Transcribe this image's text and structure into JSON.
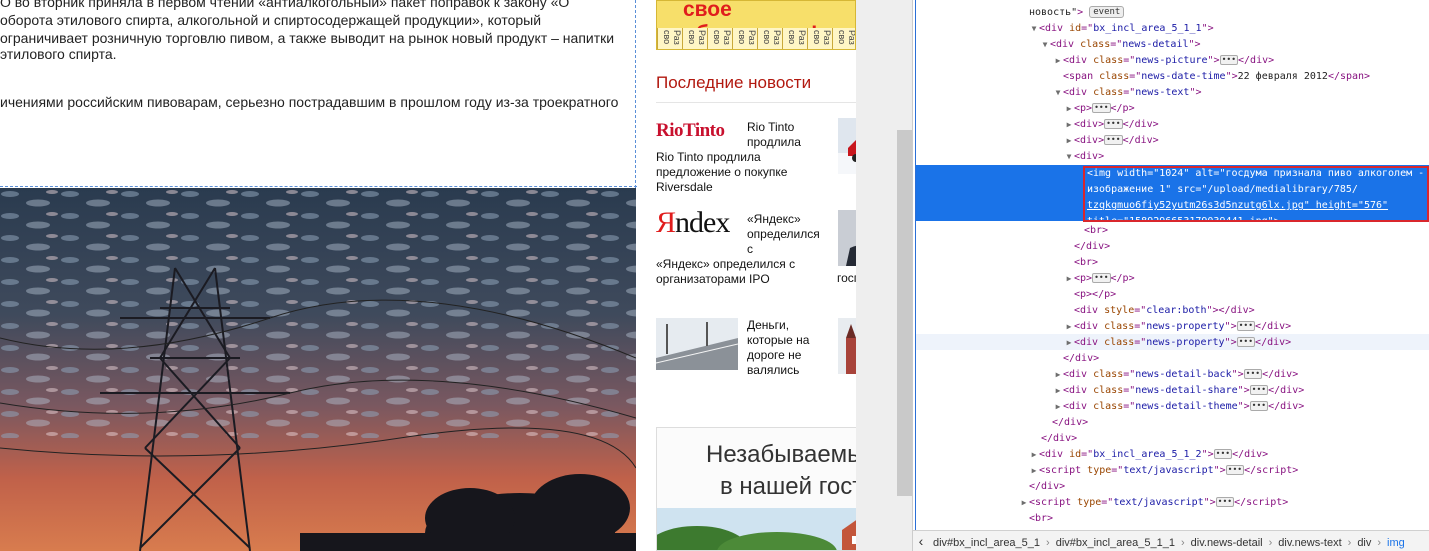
{
  "article": {
    "lines": [
      "О во вторник приняла в первом чтении «антиалкогольный» пакет поправок к закону «О",
      "оборота этилового спирта, алкогольной и спиртосодержащей продукции», который",
      "ограничивает розничную торговлю пивом, а также выводит на рынок новый продукт – напитки",
      "этилового спирта.",
      "ичениями российским пивоварам, серьезно пострадавшим в прошлом году из-за троекратного"
    ]
  },
  "sidebar": {
    "top_banner": {
      "text": "свое объявление!",
      "cells": [
        "Раз сво",
        "Раз сво",
        "Раз сво",
        "Раз сво",
        "Раз сво",
        "Раз сво",
        "Раз сво",
        "Раз сво"
      ]
    },
    "latest_news_heading": "Последние новости",
    "news": [
      {
        "logo": "RioTinto",
        "text": "Rio Tinto продлила предложение о покупке Riversdale",
        "thumb": "rally-car-photo"
      },
      {
        "logo_prefix": "Я",
        "logo_rest": "ndex",
        "text": "«Яндекс» определился с организаторами IPO",
        "thumb": "putin-photo",
        "thumb_caption": "госпредпр"
      },
      {
        "text": "Деньги, которые на дороге не валялись",
        "thumb": "kremlin-photo",
        "image": "snowy-road-photo"
      }
    ],
    "bottom_banner": {
      "line1": "Незабываемый",
      "line2": "в нашей гостин"
    }
  },
  "devtools": {
    "selected_node": {
      "line1": "<img width=\"1024\" alt=\"госдума признала пиво алкоголем -",
      "line2": "изображение 1\" src=\"/upload/medialibrary/785/",
      "line3": "tzqkgmuo6fiy52yutm26s3d5nzutg6lx.jpg\" height=\"576\"",
      "line4": "title=\"1589296653179039441.jpg\">"
    },
    "breadcrumbs": [
      "div#bx_incl_area_5_1",
      "div#bx_incl_area_5_1_1",
      "div.news-detail",
      "div.news-text",
      "div",
      "img"
    ],
    "event_badge": "event"
  },
  "colors": {
    "accent": "#1a73e8",
    "selection_outline": "#d9262c",
    "news_heading": "#b2180f"
  }
}
